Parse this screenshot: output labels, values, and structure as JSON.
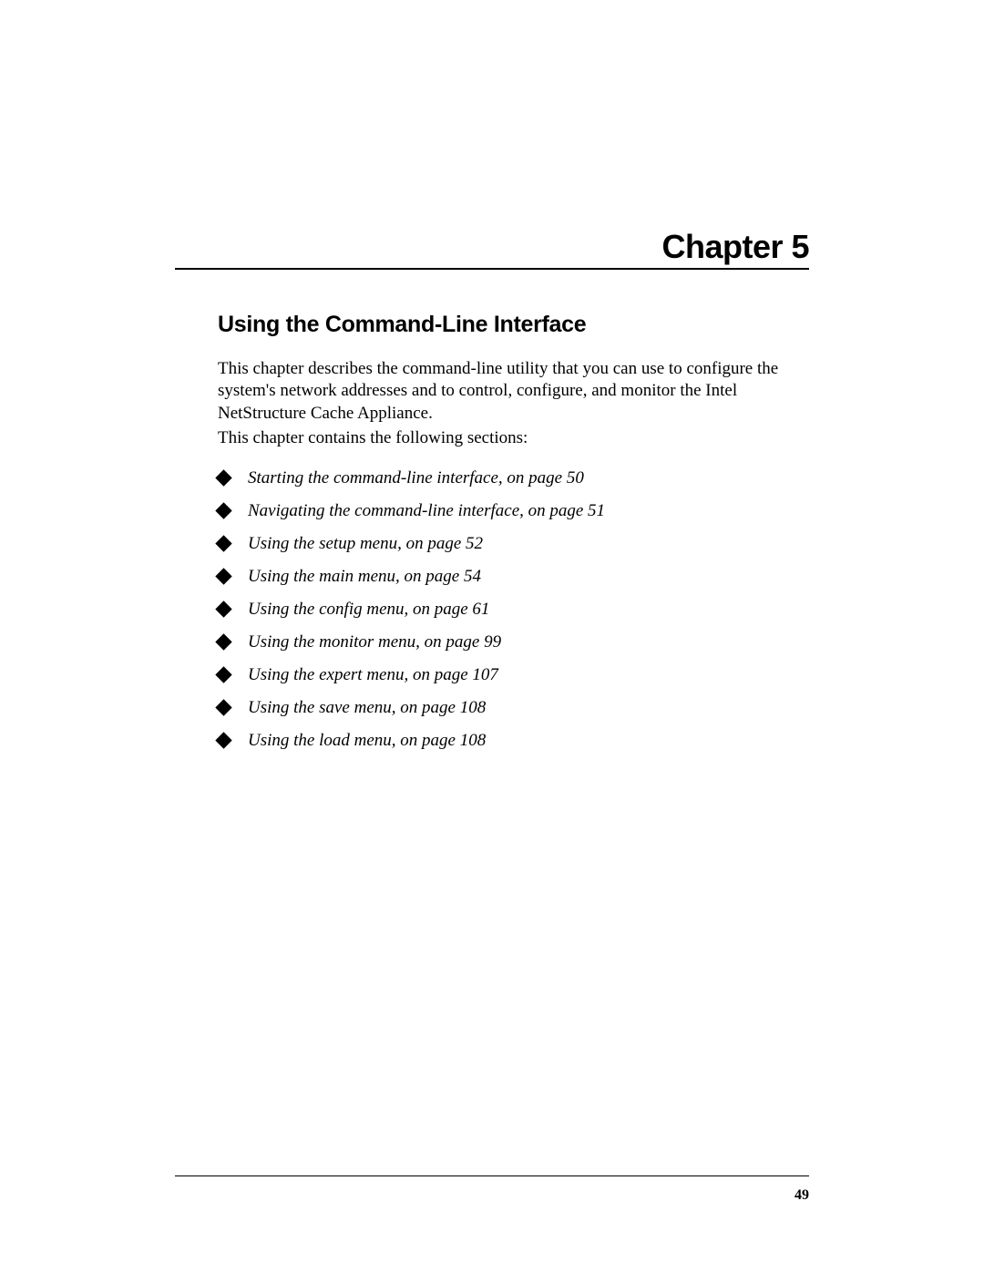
{
  "chapter": {
    "label": "Chapter 5"
  },
  "section": {
    "title": "Using the Command-Line Interface"
  },
  "intro": "This chapter describes the command-line utility that you can use to configure the system's network addresses and to control, configure, and monitor the Intel NetStructure Cache Appliance.",
  "sections_intro": "This chapter contains the following sections:",
  "bullets": [
    "Starting the command-line interface, on page 50",
    "Navigating the command-line interface, on page 51",
    "Using the setup menu, on page 52",
    "Using the main menu, on page 54",
    "Using the config menu, on page 61",
    "Using the monitor menu, on page 99",
    "Using the expert menu, on page 107",
    "Using the save menu, on page 108",
    "Using the load menu, on page 108"
  ],
  "page_number": "49"
}
